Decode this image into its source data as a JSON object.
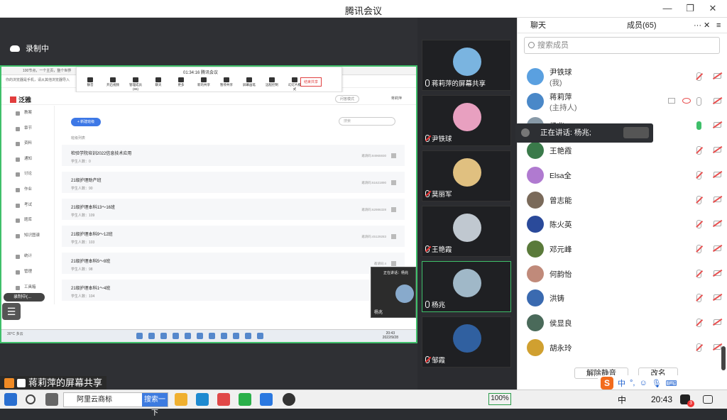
{
  "window": {
    "title": "腾讯会议",
    "min": "—",
    "restore": "❐",
    "close": "✕"
  },
  "stage": {
    "recording": "录制中",
    "share_label": "蒋莉萍的屏幕共享",
    "rec_tag": "录制中(...",
    "menu_icon": "☰"
  },
  "shared_screen": {
    "browser_bar": "100节点，一个主页，整个世界",
    "info_bar": "你的浏览器是手机，请从其他浏览器导入",
    "toolbar": {
      "time": "01:34:16",
      "name": "腾讯会议",
      "tools": [
        "静音",
        "开启视频",
        "管理成员(65)",
        "聊天",
        "更多",
        "新的共享",
        "暂停共享",
        "屏幕画笔",
        "远程控制",
        "幻灯片模式"
      ],
      "end_share": "结束共享"
    },
    "app": {
      "logo": "泛雅",
      "header_pill": "问答模式",
      "user": "蒋莉萍"
    },
    "sidebar": [
      "教案",
      "章节",
      "资料",
      "通知",
      "讨论",
      "作业",
      "考试",
      "题库",
      "知识图谱",
      "统计",
      "管理",
      "工具箱"
    ],
    "main": {
      "new_button": "+ 新建班级",
      "search_placeholder": "搜索",
      "list_header": "班级列表",
      "classes": [
        {
          "name": "检验学院培训2022信息技术应用",
          "count": "学生人数：0",
          "code": "邀请码:84965930"
        },
        {
          "name": "21级护理助产班",
          "count": "学生人数：90",
          "code": "邀请码:61621890"
        },
        {
          "name": "21级护理本科13～16班",
          "count": "学生人数：109",
          "code": "邀请码:62986328"
        },
        {
          "name": "21级护理本科9～12班",
          "count": "学生人数：103",
          "code": "邀请码:45129283"
        },
        {
          "name": "21级护理本科5～8班",
          "count": "学生人数：98",
          "code": "邀请码:4"
        },
        {
          "name": "21级护理本科1～4班",
          "count": "学生人数：104",
          "code": "邀请码:3"
        }
      ]
    },
    "mini_video": {
      "title": "正在讲话：杨兆",
      "name": "杨兆"
    },
    "taskbar": {
      "weather": "30°C",
      "weather_sub": "多云",
      "time": "20:43",
      "date": "2022/9/28"
    }
  },
  "video_tiles": [
    {
      "name": "蒋莉萍的屏幕共享",
      "color": "#7ab4e0",
      "muted": false
    },
    {
      "name": "尹铁球",
      "color": "#e8a0c0",
      "muted": true
    },
    {
      "name": "莫丽军",
      "color": "#e0c080",
      "muted": true
    },
    {
      "name": "王艳霞",
      "color": "#c0c8d0",
      "muted": true
    },
    {
      "name": "杨兆",
      "color": "#a0b8c8",
      "muted": false
    },
    {
      "name": "邹霞",
      "color": "#3060a0",
      "muted": true
    }
  ],
  "panel": {
    "tab_chat": "聊天",
    "tab_members": "成员(65)",
    "more": "···",
    "close": "✕",
    "menu": "≡",
    "search_placeholder": "搜索成员",
    "members": [
      {
        "name": "尹铁球",
        "sub": "(我)",
        "color": "#5aa0e0"
      },
      {
        "name": "蒋莉萍",
        "sub": "(主持人)",
        "color": "#4a88c8"
      },
      {
        "name": "杨兆",
        "sub": "",
        "color": "#889aa8"
      },
      {
        "name": "王艳霞",
        "sub": "",
        "color": "#3a7a4a"
      },
      {
        "name": "Elsa全",
        "sub": "",
        "color": "#b07ad0"
      },
      {
        "name": "曾志能",
        "sub": "",
        "color": "#7a6a5a"
      },
      {
        "name": "陈火英",
        "sub": "",
        "color": "#2a4a9a"
      },
      {
        "name": "邓元峰",
        "sub": "",
        "color": "#5a7a3a"
      },
      {
        "name": "何韵怡",
        "sub": "",
        "color": "#c08a7a"
      },
      {
        "name": "洪铸",
        "sub": "",
        "color": "#3a6ab0"
      },
      {
        "name": "侯显良",
        "sub": "",
        "color": "#4a6a5a"
      },
      {
        "name": "胡永玲",
        "sub": "",
        "color": "#d0a030"
      }
    ],
    "btn_mute_all": "解除静音",
    "btn_rename": "改名",
    "speaking": "正在讲话: 杨兆;"
  },
  "ime": {
    "brand": "S",
    "items": [
      "中",
      "°,",
      "☺",
      "🎙",
      "⌨"
    ]
  },
  "taskbar": {
    "search_text": "阿里云商标",
    "search_go": "搜索一下",
    "battery": "100%",
    "ime": "中",
    "clock": "20:43",
    "badge": "3"
  },
  "colors": {
    "accent": "#3d78e6",
    "share_border": "#3fbf6a",
    "muted_red": "#e85050"
  }
}
